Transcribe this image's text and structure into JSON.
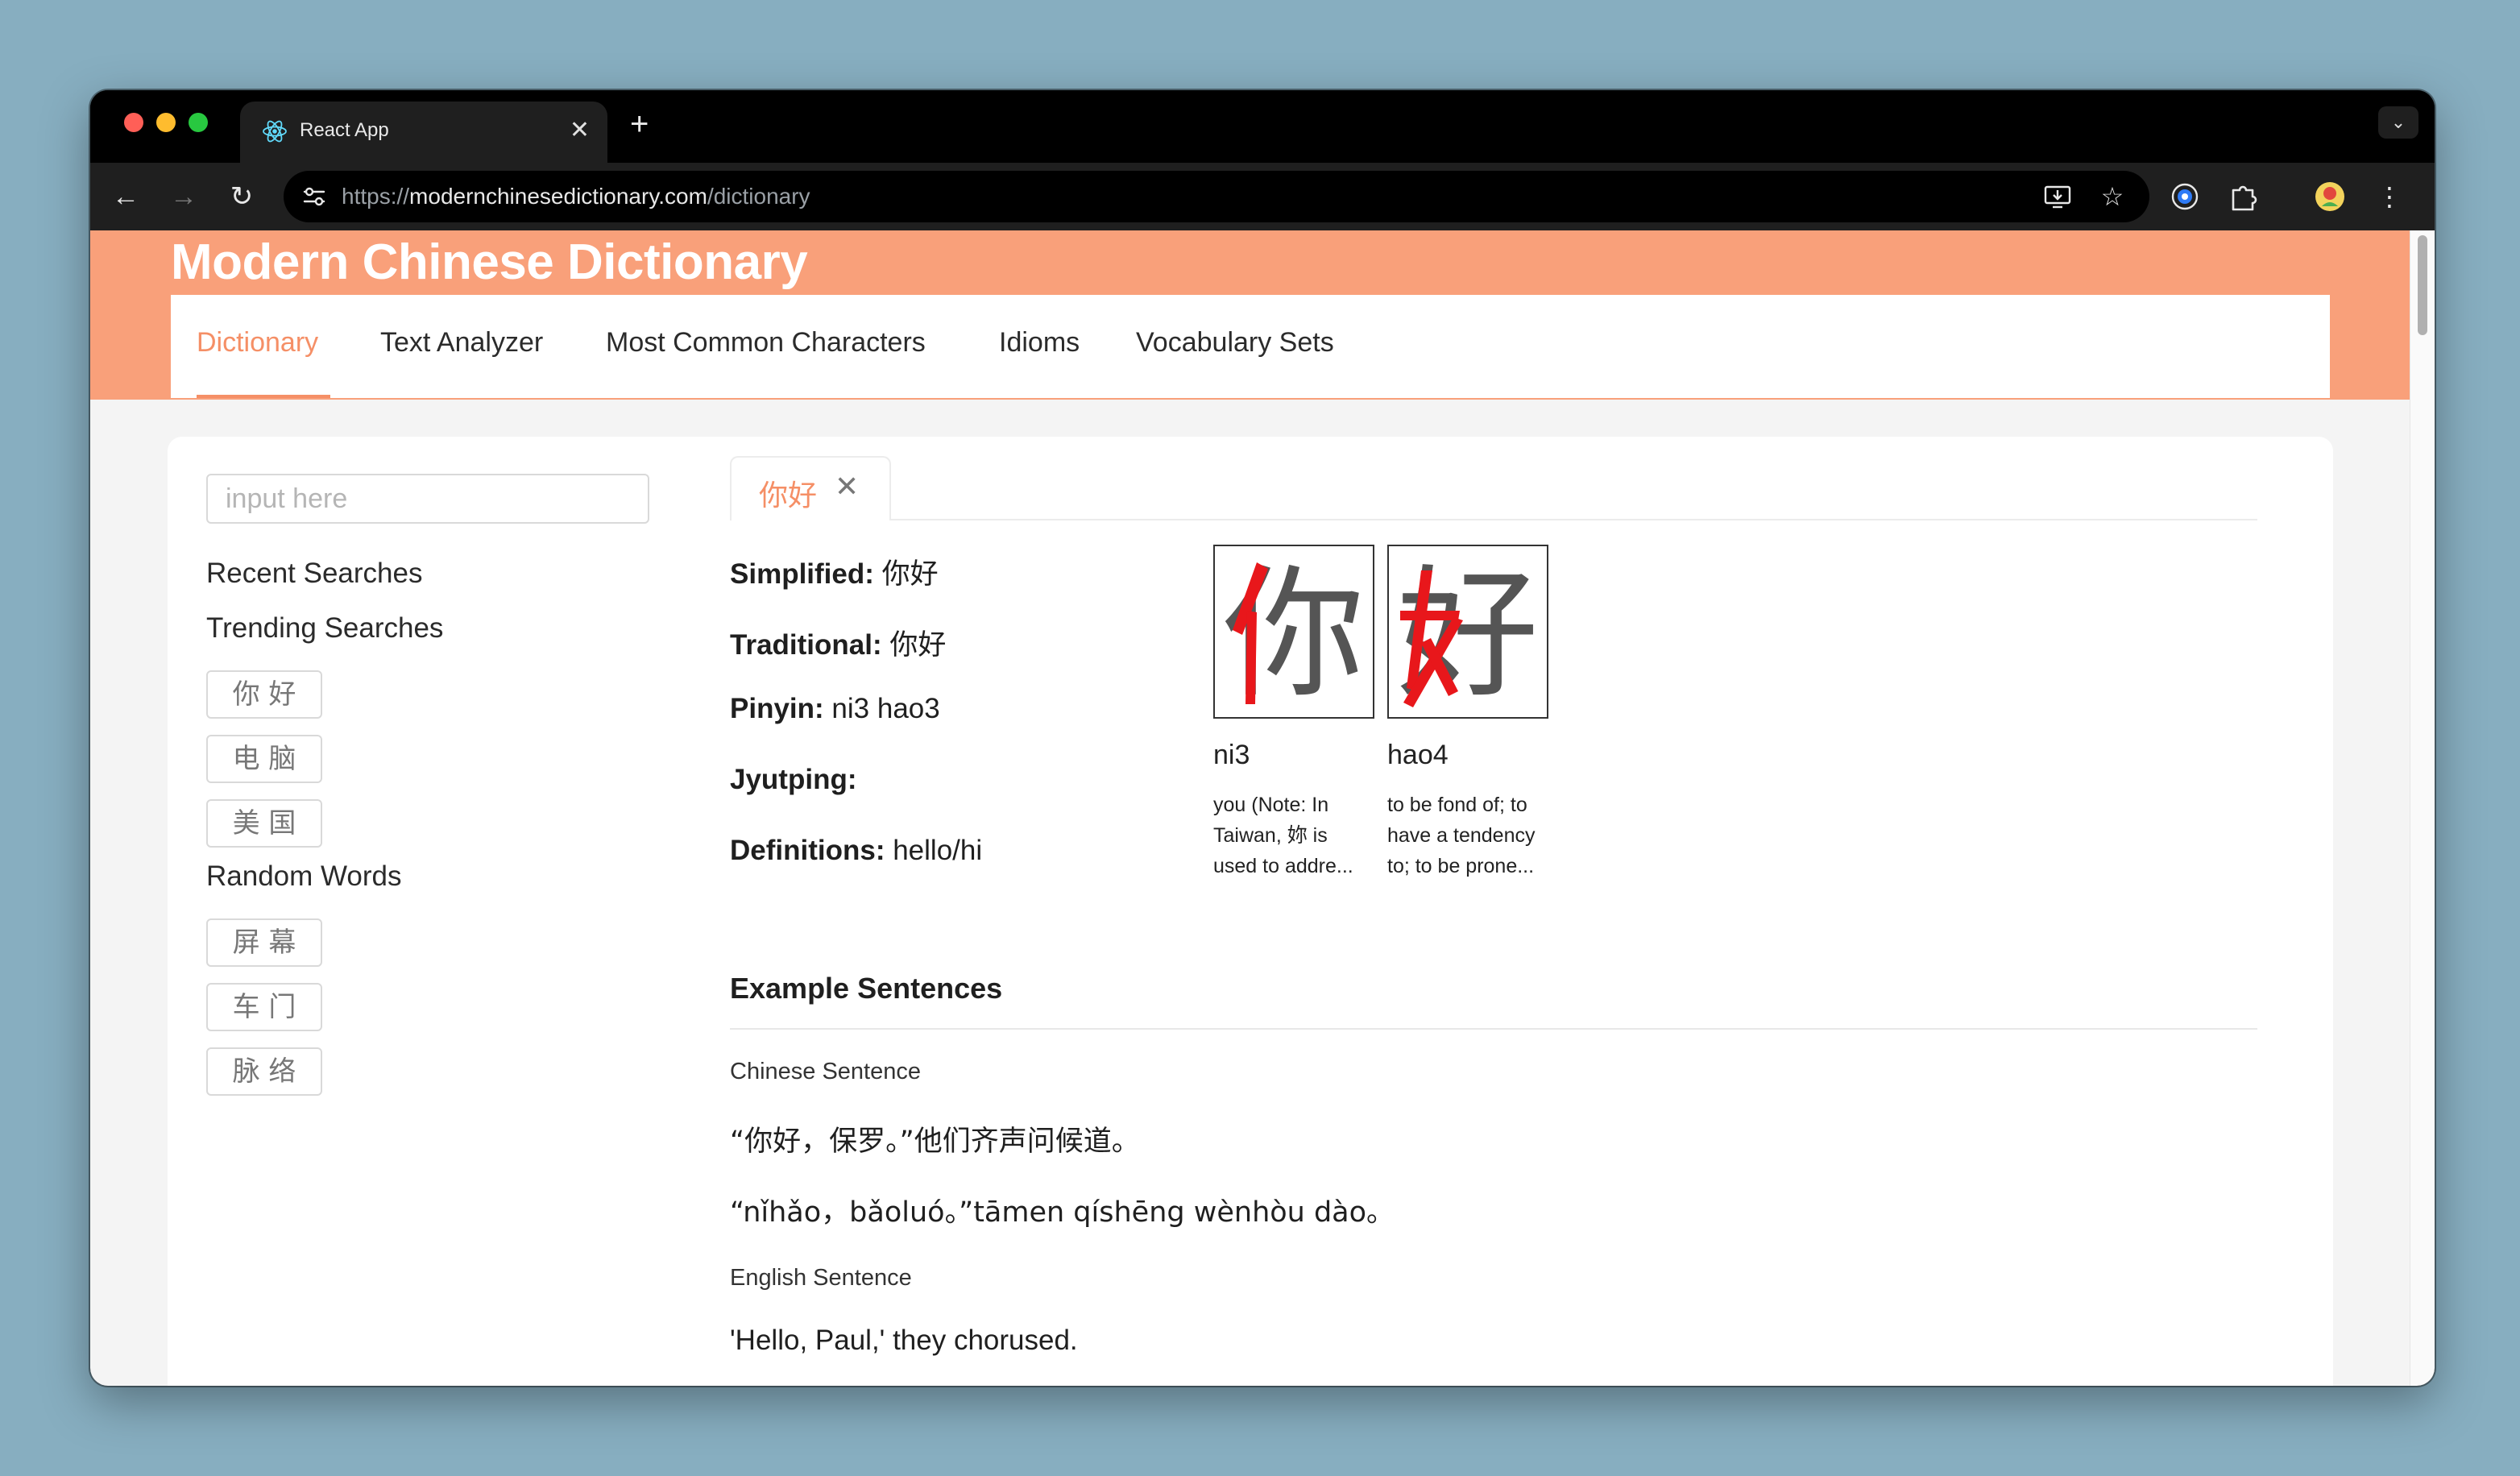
{
  "browser": {
    "tab_title": "React App",
    "url_scheme": "https://",
    "url_host": "modernchinesedictionary.com",
    "url_path": "/dictionary",
    "icons": [
      "react-favicon",
      "close-icon",
      "plus-icon",
      "chevron-down-icon",
      "back-arrow-icon",
      "forward-arrow-icon",
      "reload-icon",
      "tune-icon",
      "install-icon",
      "star-icon",
      "extension-circle-icon",
      "puzzle-icon",
      "avatar",
      "kebab-menu-icon"
    ]
  },
  "site": {
    "title": "Modern Chinese Dictionary",
    "accent_color": "#f9a07a",
    "nav": [
      {
        "label": "Dictionary",
        "active": true
      },
      {
        "label": "Text Analyzer"
      },
      {
        "label": "Most Common Characters"
      },
      {
        "label": "Idioms"
      },
      {
        "label": "Vocabulary Sets"
      }
    ]
  },
  "sidebar": {
    "search_placeholder": "input here",
    "recent_heading": "Recent Searches",
    "trending_heading": "Trending Searches",
    "trending": [
      "你 好",
      "电 脑",
      "美 国"
    ],
    "random_heading": "Random Words",
    "random": [
      "屏 幕",
      "车 门",
      "脉 络"
    ]
  },
  "word_tab": {
    "label": "你好",
    "close": "✕"
  },
  "entry": {
    "simplified_label": "Simplified:",
    "simplified": "你好",
    "traditional_label": "Traditional:",
    "traditional": "你好",
    "pinyin_label": "Pinyin:",
    "pinyin": "ni3 hao3",
    "jyutping_label": "Jyutping:",
    "jyutping": "",
    "definitions_label": "Definitions:",
    "definitions": "hello/hi"
  },
  "characters": [
    {
      "char": "你",
      "pinyin": "ni3",
      "def_lines": [
        "you (Note: In",
        "Taiwan, 妳 is",
        "used to addre..."
      ]
    },
    {
      "char": "好",
      "pinyin": "hao4",
      "def_lines": [
        "to be fond of; to",
        "have a tendency",
        "to; to be prone..."
      ]
    }
  ],
  "examples": {
    "heading": "Example Sentences",
    "chinese_label": "Chinese Sentence",
    "chinese": "“你好，保罗。”他们齐声问候道。",
    "pinyin": "“nǐhǎo，bǎoluó。”tāmen qíshēng wènhòu dào。",
    "english_label": "English Sentence",
    "english": "'Hello, Paul,' they chorused."
  }
}
